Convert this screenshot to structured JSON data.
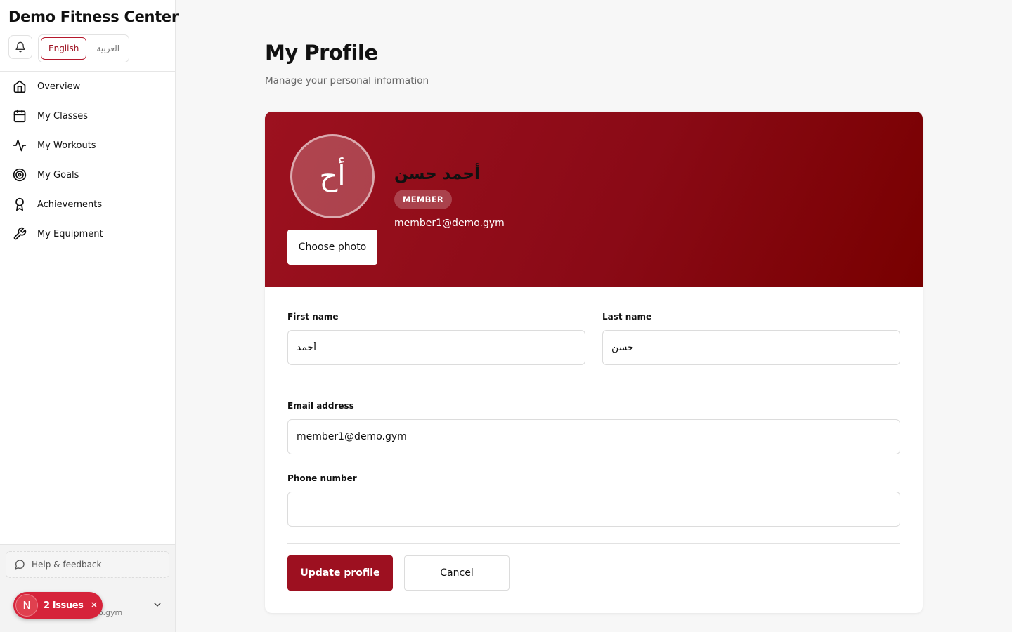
{
  "sidebar": {
    "brand": "Demo Fitness Center",
    "languages": {
      "english": "English",
      "arabic": "العربية",
      "active": "English"
    },
    "nav": [
      {
        "label": "Overview",
        "icon": "home-icon"
      },
      {
        "label": "My Classes",
        "icon": "calendar-icon"
      },
      {
        "label": "My Workouts",
        "icon": "activity-icon"
      },
      {
        "label": "My Goals",
        "icon": "target-icon"
      },
      {
        "label": "Achievements",
        "icon": "award-icon"
      },
      {
        "label": "My Equipment",
        "icon": "wrench-icon"
      }
    ],
    "help": "Help & feedback",
    "user_email_fragment": "o.gym"
  },
  "issues": {
    "initial": "N",
    "label": "2 Issues"
  },
  "main": {
    "title": "My Profile",
    "subtitle": "Manage your personal information",
    "profile": {
      "initials": "أح",
      "name": "أحمد حسن",
      "role": "MEMBER",
      "email": "member1@demo.gym",
      "choose_photo": "Choose photo"
    },
    "form": {
      "first_name_label": "First name",
      "first_name": "أحمد",
      "last_name_label": "Last name",
      "last_name": "حسن",
      "email_label": "Email address",
      "email": "member1@demo.gym",
      "phone_label": "Phone number",
      "phone": "",
      "update_label": "Update profile",
      "cancel_label": "Cancel"
    }
  },
  "colors": {
    "accent": "#9d1020",
    "banner_start": "#9c111f",
    "banner_end": "#780000",
    "issues": "#d6233a"
  }
}
